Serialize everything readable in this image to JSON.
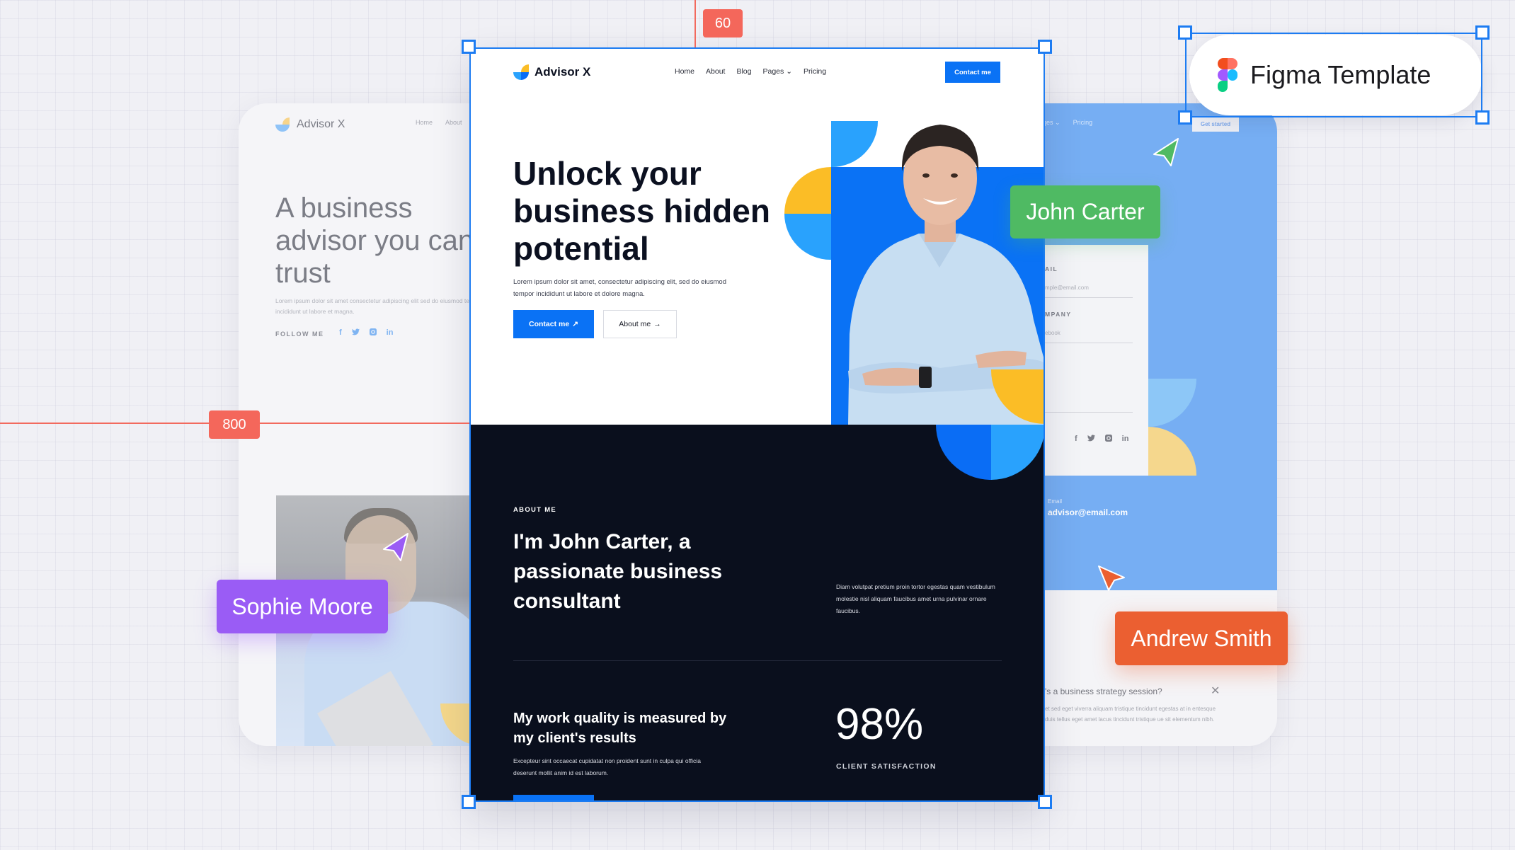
{
  "canvas": {
    "background_color": "#f0f0f5",
    "rulers": [
      {
        "axis": "vertical",
        "value": "60",
        "color": "#f4675b"
      },
      {
        "axis": "horizontal",
        "value": "800",
        "color": "#f4675b"
      }
    ],
    "selection_color": "#1d7cf2"
  },
  "figma_badge": {
    "label": "Figma Template",
    "icon": "figma-logo-icon"
  },
  "collaborators": [
    {
      "name": "John Carter",
      "color": "#4fba63",
      "cursor_icon": "cursor-arrow-icon"
    },
    {
      "name": "Sophie Moore",
      "color": "#9a5cf5",
      "cursor_icon": "cursor-arrow-icon"
    },
    {
      "name": "Andrew Smith",
      "color": "#eb5f31",
      "cursor_icon": "cursor-arrow-icon"
    }
  ],
  "left_card": {
    "logo_text": "Advisor X",
    "nav": [
      "Home",
      "About"
    ],
    "title": "A business advisor you can trust",
    "subtitle": "Lorem ipsum dolor sit amet consectetur adipiscing elit  sed do eiusmod tempor incididunt ut labore et magna.",
    "follow_label": "FOLLOW ME",
    "social": [
      {
        "icon": "facebook-icon",
        "glyph": "f"
      },
      {
        "icon": "twitter-icon",
        "glyph": "🐦"
      },
      {
        "icon": "instagram-icon",
        "glyph": "◙"
      },
      {
        "icon": "linkedin-icon",
        "glyph": "in"
      }
    ]
  },
  "main_card": {
    "logo_text": "Advisor X",
    "nav": [
      {
        "label": "Home"
      },
      {
        "label": "About"
      },
      {
        "label": "Blog"
      },
      {
        "label": "Pages",
        "has_dropdown": true
      },
      {
        "label": "Pricing"
      }
    ],
    "nav_cta": "Contact me",
    "hero": {
      "title": "Unlock your business hidden potential",
      "subtitle": "Lorem ipsum dolor sit amet, consectetur adipiscing elit, sed do eiusmod tempor incididunt ut labore et dolore magna.",
      "primary_button": "Contact me",
      "primary_icon": "↗",
      "secondary_button": "About me",
      "secondary_icon": "→"
    },
    "about": {
      "label": "ABOUT ME",
      "title": "I'm John Carter, a passionate business consultant",
      "description": "Diam volutpat pretium proin tortor egestas quam vestibulum molestie nisl aliquam faucibus amet urna pulvinar ornare faucibus."
    },
    "quality": {
      "title": "My work quality is measured by my client's results",
      "description": "Excepteur sint occaecat cupidatat non proident sunt in culpa qui officia deserunt mollit anim id est laborum.",
      "stat_value": "98%",
      "stat_label": "CLIENT SATISFACTION"
    },
    "colors": {
      "primary": "#0a72f5",
      "accent_light": "#29a2fd",
      "accent_yellow": "#fbbd26",
      "dark": "#0a0f1d"
    }
  },
  "right_card": {
    "nav": [
      {
        "label": "ages",
        "has_dropdown": true
      },
      {
        "label": "Pricing"
      }
    ],
    "cta": "Get started",
    "form": [
      {
        "label": "AIL",
        "placeholder": "mple@email.com"
      },
      {
        "label": "MPANY",
        "placeholder": "ebook"
      }
    ],
    "social": [
      {
        "icon": "facebook-icon",
        "glyph": "f"
      },
      {
        "icon": "twitter-icon",
        "glyph": "🐦"
      },
      {
        "icon": "instagram-icon",
        "glyph": "◙"
      },
      {
        "icon": "linkedin-icon",
        "glyph": "in"
      }
    ],
    "email_label": "Email",
    "email_value": "advisor@email.com",
    "faq": {
      "question": "'s a business strategy session?",
      "answer": "et sed eget viverra aliquam tristique tincidunt egestas at in entesque duis tellus eget amet lacus tincidunt tristique ue sit elementum nibh."
    }
  }
}
